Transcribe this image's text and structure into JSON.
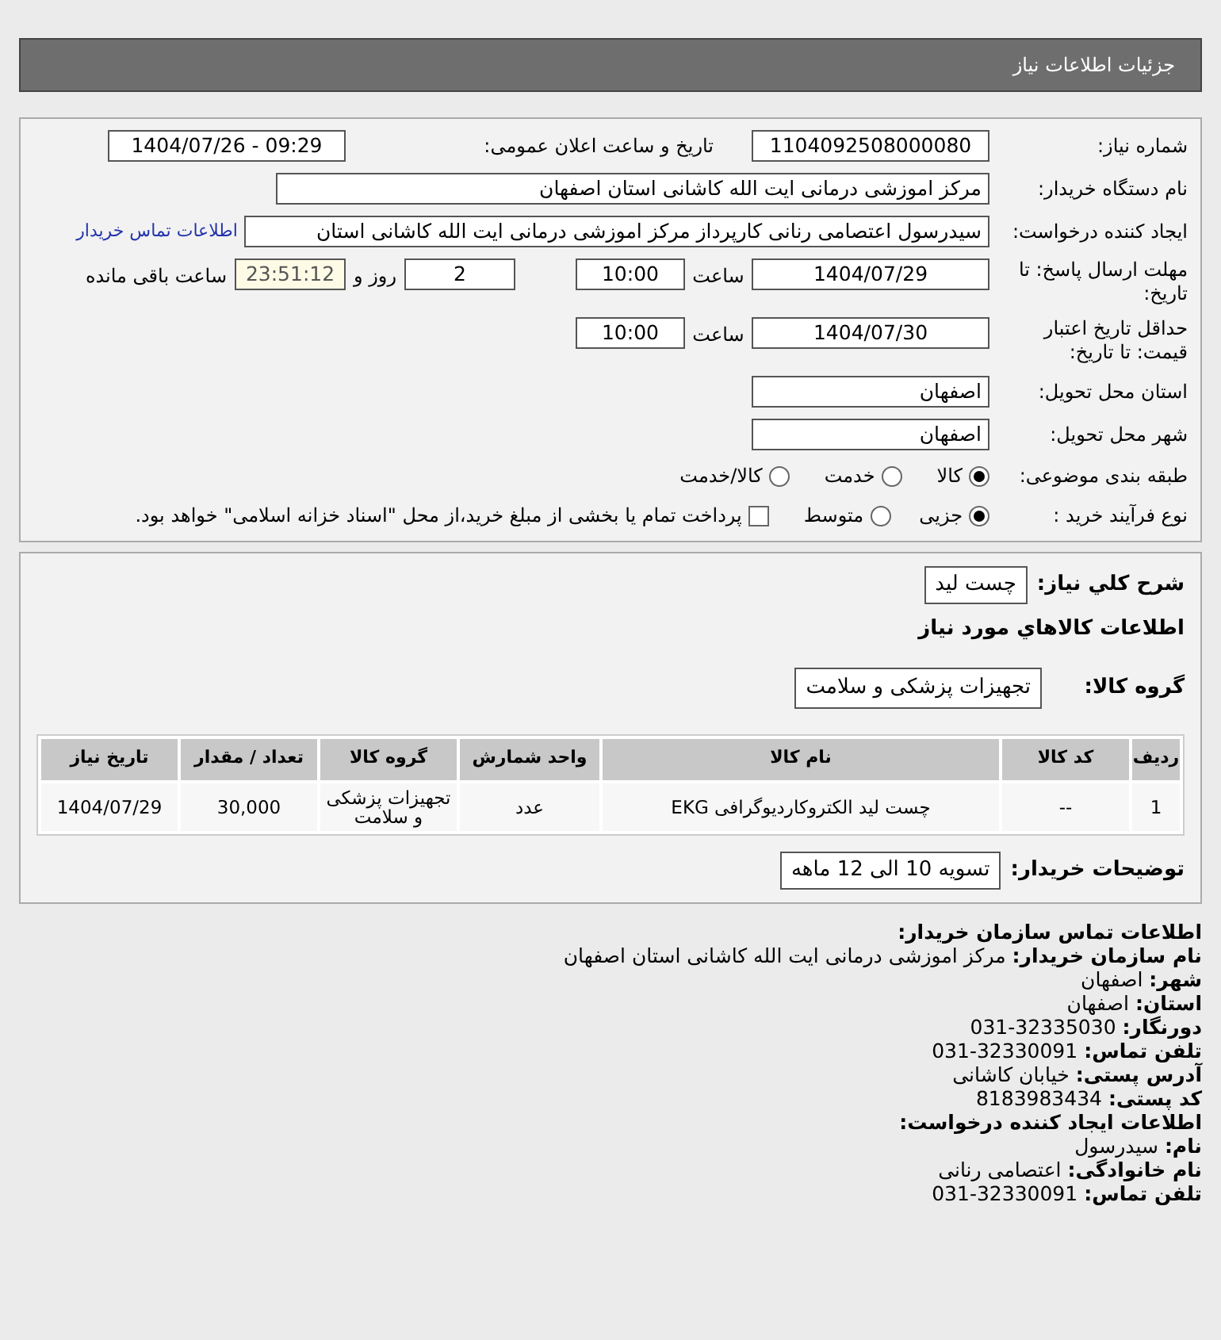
{
  "page_title": "جزئیات اطلاعات نیاز",
  "need_number": {
    "label": "شماره نیاز:",
    "value": "1104092508000080"
  },
  "announce": {
    "label": "تاریخ و ساعت اعلان عمومی:",
    "value": "1404/07/26 - 09:29"
  },
  "buyer_org": {
    "label": "نام دستگاه خریدار:",
    "value": "مرکز اموزشی درمانی ایت الله کاشانی استان اصفهان"
  },
  "requester": {
    "label": "ایجاد کننده درخواست:",
    "value": "سیدرسول اعتصامی رنانی کارپرداز مرکز اموزشی درمانی ایت الله کاشانی استان",
    "link": "اطلاعات تماس خریدار"
  },
  "reply_deadline": {
    "label": "مهلت ارسال پاسخ: تا تاریخ:",
    "date": "1404/07/29",
    "time_label": "ساعت",
    "time": "10:00",
    "days": "2",
    "days_label": "روز و",
    "remaining": "23:51:12",
    "remaining_label": "ساعت باقی مانده"
  },
  "price_validity": {
    "label": "حداقل تاریخ اعتبار قیمت: تا تاریخ:",
    "date": "1404/07/30",
    "time_label": "ساعت",
    "time": "10:00"
  },
  "province": {
    "label": "استان محل تحویل:",
    "value": "اصفهان"
  },
  "city": {
    "label": "شهر محل تحویل:",
    "value": "اصفهان"
  },
  "category": {
    "label": "طبقه بندی موضوعی:",
    "options": [
      {
        "label": "کالا",
        "selected": true
      },
      {
        "label": "خدمت",
        "selected": false
      },
      {
        "label": "کالا/خدمت",
        "selected": false
      }
    ]
  },
  "process": {
    "label": "نوع فرآیند خرید :",
    "options": [
      {
        "label": "جزیی",
        "selected": true
      },
      {
        "label": "متوسط",
        "selected": false
      }
    ],
    "payment_checkbox": {
      "label": "پرداخت تمام یا بخشی از مبلغ خرید،از محل \"اسناد خزانه اسلامی\" خواهد بود.",
      "checked": false
    }
  },
  "summary": {
    "label": "شرح کلي نياز:",
    "value": "چست لید"
  },
  "goods_heading": "اطلاعات کالاهاي مورد نياز",
  "goods_group": {
    "label": "گروه کالا:",
    "value": "تجهیزات پزشکی و سلامت"
  },
  "table": {
    "columns": [
      "ردیف",
      "کد کالا",
      "نام کالا",
      "واحد شمارش",
      "گروه کالا",
      "تعداد / مقدار",
      "تاریخ نیاز"
    ],
    "rows": [
      [
        "1",
        "--",
        "چست لید الکتروکاردیوگرافی EKG",
        "عدد",
        "تجهیزات پزشکی و سلامت",
        "30,000",
        "1404/07/29"
      ]
    ]
  },
  "buyer_notes": {
    "label": "توضیحات خریدار:",
    "value": "تسویه 10 الی 12 ماهه"
  },
  "contact": [
    {
      "kind": "heading",
      "label": "اطلاعات تماس سازمان خریدار:"
    },
    {
      "kind": "line",
      "label": "نام سازمان خریدار:",
      "value": "مرکز اموزشی درمانی ایت الله کاشانی استان اصفهان"
    },
    {
      "kind": "line",
      "label": "شهر:",
      "value": "اصفهان"
    },
    {
      "kind": "line",
      "label": "استان:",
      "value": "اصفهان"
    },
    {
      "kind": "line",
      "label": "دورنگار:",
      "value": "32335030-031"
    },
    {
      "kind": "line",
      "label": "تلفن تماس:",
      "value": "32330091-031"
    },
    {
      "kind": "line",
      "label": "آدرس پستی:",
      "value": "خیابان کاشانی"
    },
    {
      "kind": "line",
      "label": "کد پستی:",
      "value": "8183983434"
    },
    {
      "kind": "heading",
      "label": "اطلاعات ایجاد کننده درخواست:"
    },
    {
      "kind": "line",
      "label": "نام:",
      "value": "سیدرسول"
    },
    {
      "kind": "line",
      "label": "نام خانوادگی:",
      "value": "اعتصامی رنانی"
    },
    {
      "kind": "line",
      "label": "تلفن تماس:",
      "value": "32330091-031"
    }
  ]
}
